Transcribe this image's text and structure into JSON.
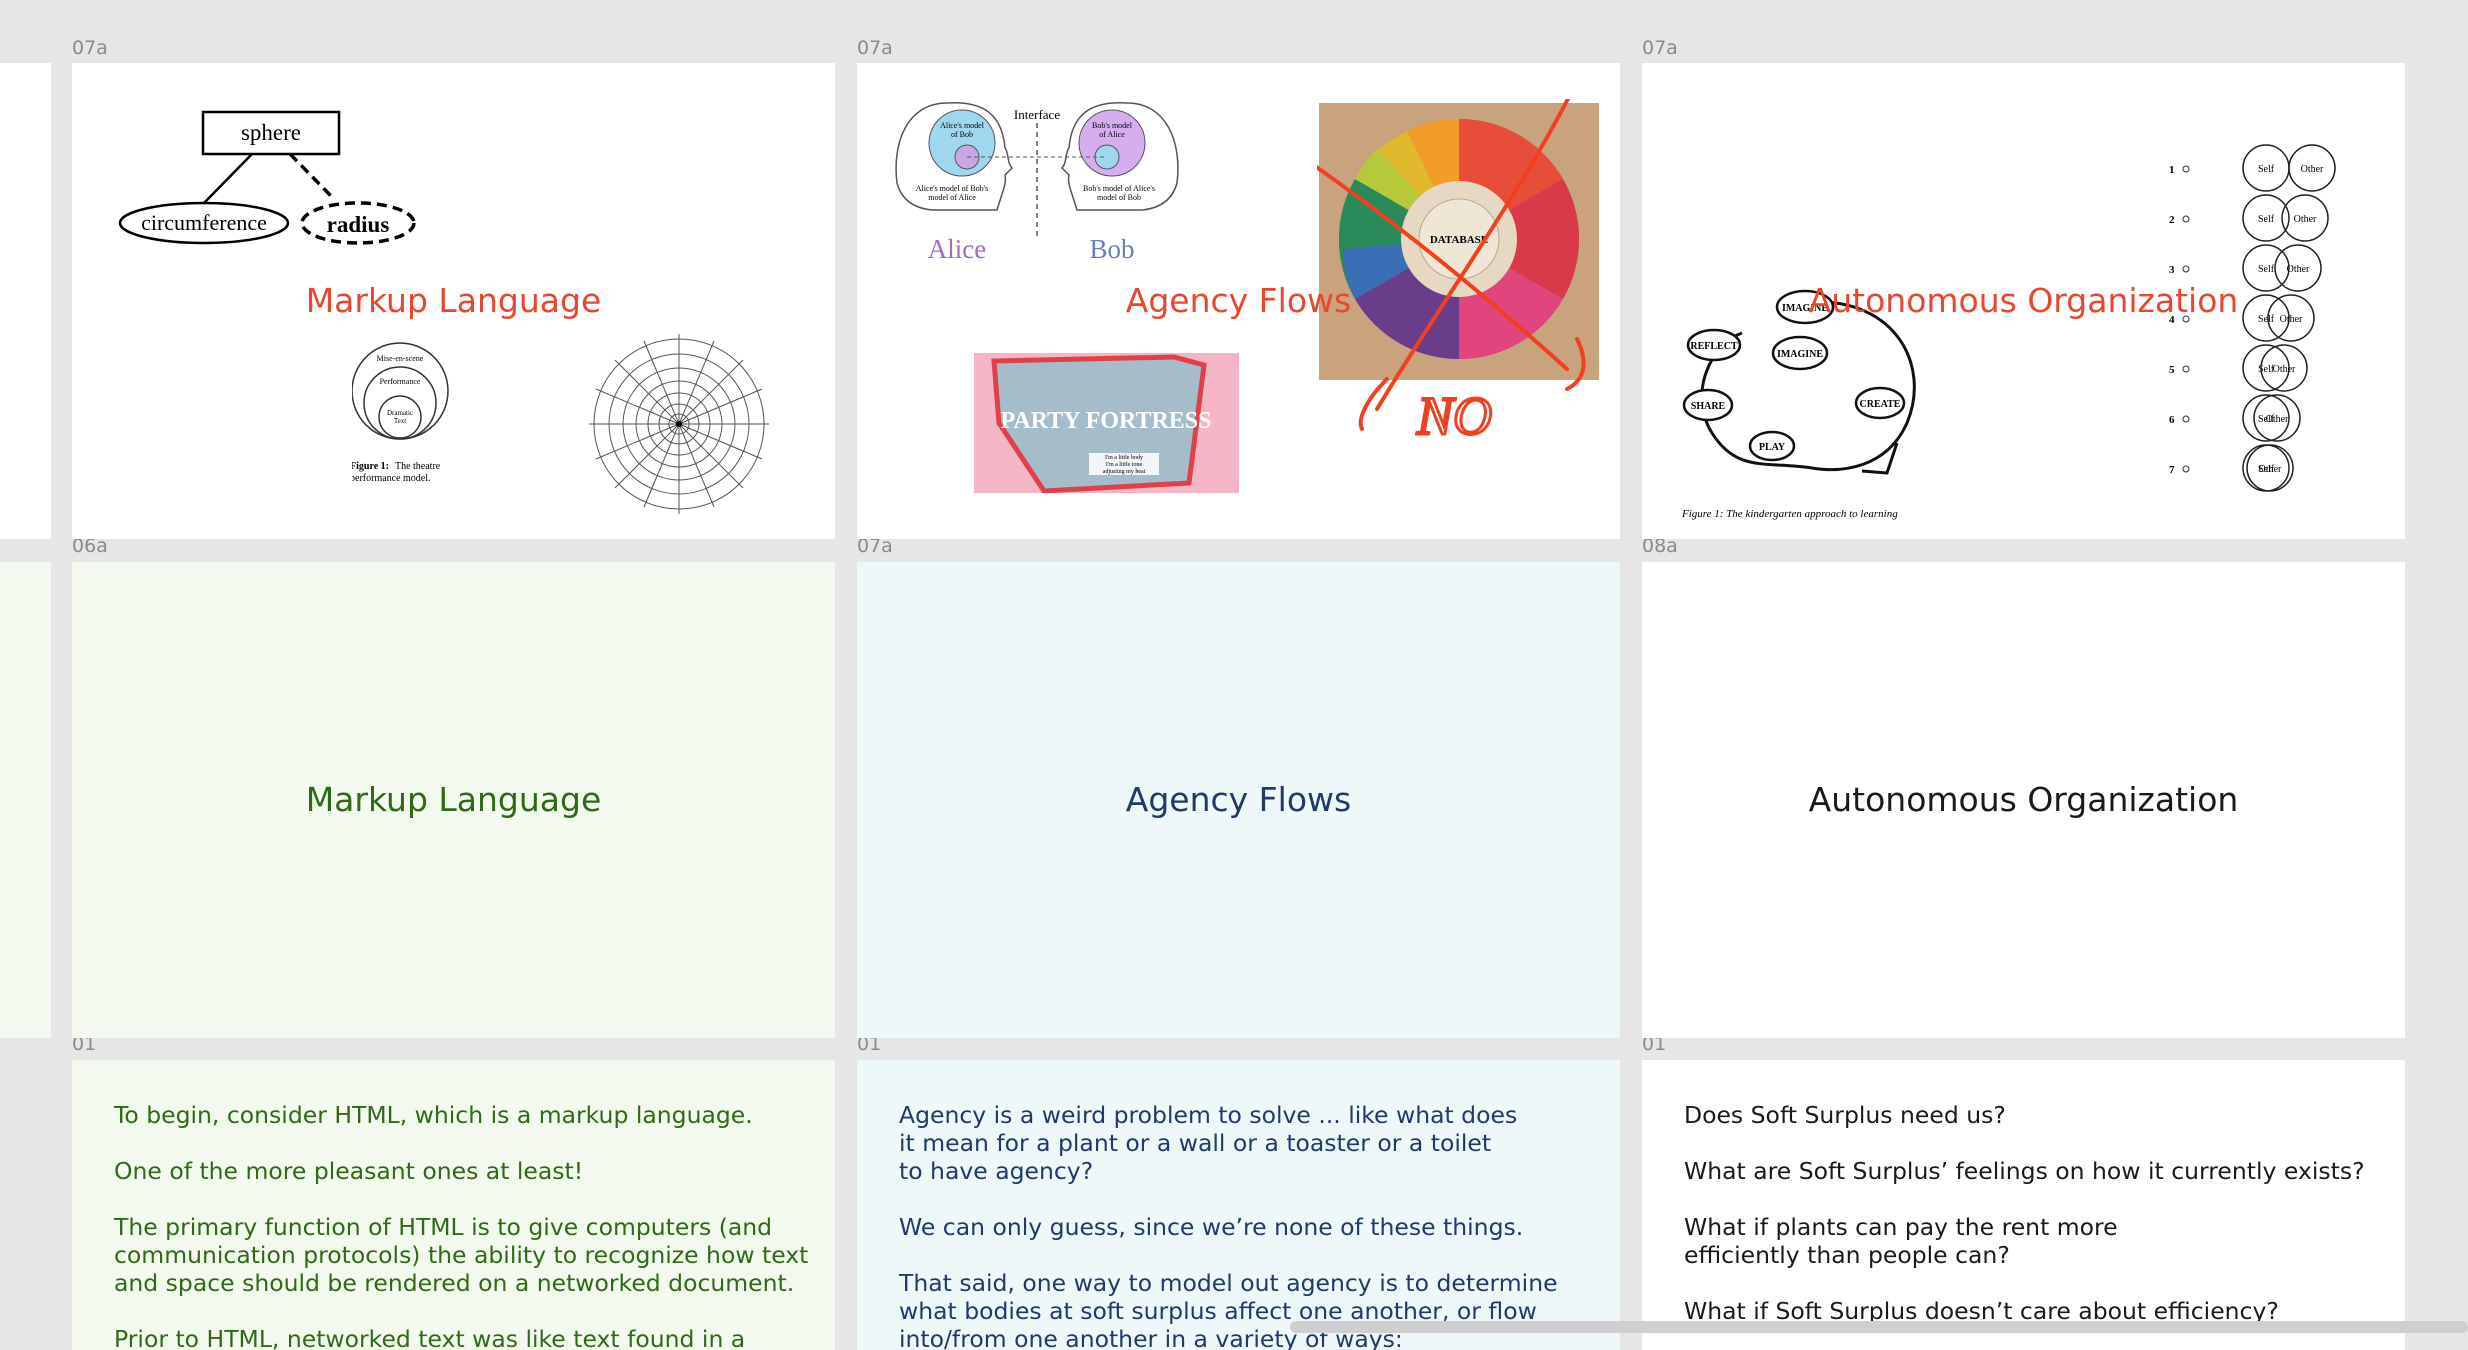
{
  "canvas": {
    "labels": {
      "r1c1": "07a",
      "r1c2": "07a",
      "r1c3": "07a",
      "r2c1": "06a",
      "r2c2": "07a",
      "r2c3": "08a",
      "r3c1": "01",
      "r3c2": "01",
      "r3c3": "01"
    }
  },
  "slides": {
    "markup_collage": {
      "title": "Markup Language",
      "diagram": {
        "top": "sphere",
        "left": "circumference",
        "right": "radius"
      },
      "theatre": {
        "outer": "Mise-en-scene",
        "mid": "Performance",
        "inner1": "Dramatic",
        "inner2": "Text",
        "caption_bold": "Figure 1:",
        "caption_rest": "The theatre",
        "caption_line2": "performance model."
      }
    },
    "agency_collage": {
      "title": "Agency Flows",
      "heads": {
        "interface": "Interface",
        "alice_model_bob_1": "Alice's model",
        "alice_model_bob_2": "of Bob",
        "bob_model_alice_1": "Bob's model",
        "bob_model_alice_2": "of Alice",
        "alice_model_alice_1": "Alice's model of Bob's",
        "alice_model_alice_2": "model of Alice",
        "bob_model_bob_1": "Bob's model of Alice's",
        "bob_model_bob_2": "model of Bob",
        "alice": "Alice",
        "bob": "Bob"
      },
      "party": "PARTY FORTRESS",
      "party_note_1": "I'm a little body",
      "party_note_2": "I'm a little tone",
      "party_note_3": "adjusting my heat",
      "wheel_center": "DATABASE",
      "scribble": "NO"
    },
    "auton_collage": {
      "title": "Autonomous Organization",
      "cycle": {
        "n1": "IMAGINE",
        "n2": "REFLECT",
        "n3": "IMAGINE",
        "n4": "CREATE",
        "n5": "SHARE",
        "n6": "PLAY",
        "caption": "Figure 1: The kindergarten approach to learning"
      },
      "scale": [
        {
          "num": "1",
          "self": "Self",
          "other": "Other"
        },
        {
          "num": "2",
          "self": "Self",
          "other": "Other"
        },
        {
          "num": "3",
          "self": "Self",
          "other": "Other"
        },
        {
          "num": "4",
          "self": "Self",
          "other": "Other"
        },
        {
          "num": "5",
          "self": "Self",
          "other": "Other"
        },
        {
          "num": "6",
          "self": "Self",
          "other": "Other"
        },
        {
          "num": "7",
          "self": "Self",
          "other": "Other"
        }
      ]
    },
    "markup_title": {
      "title": "Markup Language"
    },
    "agency_title": {
      "title": "Agency Flows"
    },
    "auton_title": {
      "title": "Autonomous Organization"
    },
    "markup_text": {
      "paragraphs": [
        "To begin, consider HTML, which is a markup language.",
        "One of the more pleasant ones at least!",
        "The primary function of HTML is to give computers (and\ncommunication protocols) the ability to recognize how text\nand space should be rendered on a networked document.",
        "Prior to HTML, networked text was like text found in a"
      ]
    },
    "agency_text": {
      "paragraphs": [
        "Agency is a weird problem to solve ... like what does\nit mean for a plant or a wall or a toaster or a toilet\nto have agency?",
        "We can only guess, since we’re none of these things.",
        "That said, one way to model out agency is to determine\nwhat bodies at soft surplus affect one another, or flow\ninto/from one another in a variety of ways:"
      ]
    },
    "auton_text": {
      "paragraphs": [
        "Does Soft Surplus need us?",
        "What are Soft Surplus’ feelings on how it currently exists?",
        "What if plants can pay the rent more\nefficiently than people can?",
        "What if Soft Surplus doesn’t care about efficiency?"
      ]
    }
  },
  "colors": {
    "canvas": "#e6e6e6",
    "label": "#8a8a8a",
    "collage_title": "#e8472e",
    "green_bg": "#f3f9ee",
    "green_text": "#2f6b17",
    "blue_bg": "#eef8f8",
    "blue_text": "#1f3a6b",
    "black_text": "#1a1a1a",
    "scrollbar": "#cfcfcf"
  }
}
